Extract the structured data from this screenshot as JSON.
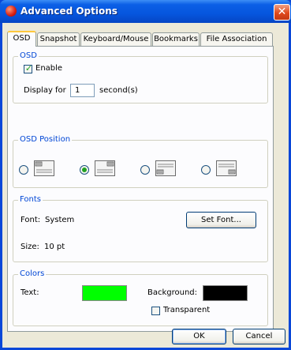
{
  "window": {
    "title": "Advanced Options",
    "close_glyph": "✕"
  },
  "tabs": [
    {
      "label": "OSD",
      "active": true
    },
    {
      "label": "Snapshot",
      "active": false
    },
    {
      "label": "Keyboard/Mouse",
      "active": false
    },
    {
      "label": "Bookmarks",
      "active": false
    },
    {
      "label": "File Association",
      "active": false
    }
  ],
  "osd": {
    "legend": "OSD",
    "enable_label": "Enable",
    "enable_checked": true,
    "display_for_label": "Display for",
    "display_for_value": "1",
    "display_unit": "second(s)"
  },
  "osd_position": {
    "legend": "OSD Position",
    "selected_index": 1,
    "options": [
      "top-left",
      "top-right",
      "bottom-left",
      "bottom-right"
    ]
  },
  "fonts": {
    "legend": "Fonts",
    "font_label": "Font:",
    "font_value": "System",
    "size_label": "Size:",
    "size_value": "10 pt",
    "set_font_button": "Set Font..."
  },
  "colors": {
    "legend": "Colors",
    "text_label": "Text:",
    "text_color": "#00ff00",
    "background_label": "Background:",
    "background_color": "#000000",
    "transparent_label": "Transparent",
    "transparent_checked": false
  },
  "footer": {
    "ok_button": "OK",
    "cancel_button": "Cancel"
  }
}
